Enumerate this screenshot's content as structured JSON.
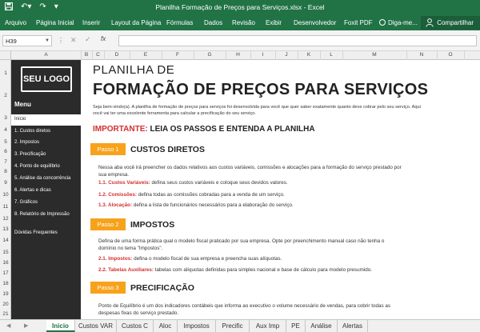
{
  "window": {
    "title": "Planilha Formação de Preços para Serviços.xlsx - Excel"
  },
  "ribbon": {
    "tabs": [
      "Arquivo",
      "Página Inicial",
      "Inserir",
      "Layout da Página",
      "Fórmulas",
      "Dados",
      "Revisão",
      "Exibir",
      "Desenvolvedor",
      "Foxit PDF"
    ],
    "tell_me": "Diga-me...",
    "share": "Compartilhar"
  },
  "formula_bar": {
    "name_box": "H39",
    "fx": "fx",
    "value": ""
  },
  "columns": [
    "A",
    "B",
    "C",
    "D",
    "E",
    "F",
    "G",
    "H",
    "I",
    "J",
    "K",
    "L",
    "M",
    "N",
    "O"
  ],
  "rows": [
    "1",
    "2",
    "3",
    "4",
    "5",
    "6",
    "7",
    "8",
    "9",
    "10",
    "11",
    "12",
    "13",
    "14",
    "15",
    "16",
    "17",
    "18",
    "19",
    "20",
    "21"
  ],
  "sidebar": {
    "logo": "SEU LOGO",
    "menu_title": "Menu",
    "items": [
      "Início",
      "1. Custos diretos",
      "2. Impostos",
      "3. Precificação",
      "4. Ponto de equilíbrio",
      "5. Análise da concorrência",
      "6. Alertas e dicas",
      "7. Gráficos",
      "8. Relatório de Impressão",
      "Dúvidas Frequentes"
    ],
    "active_index": 0
  },
  "content": {
    "subtitle": "PLANILHA DE",
    "title": "FORMAÇÃO DE PREÇOS PARA SERVIÇOS",
    "intro": "Seja bem-vindo(a). A planilha de formação de preços para serviços foi desenvolvida para você que quer saber exatamente quanto deve cobrar pelo seu serviço. Aqui você vai ter uma excelente ferramenta para calcular a precificação do seu serviço.",
    "important_label": "IMPORTANTE:",
    "important_text": "LEIA OS PASSOS E ENTENDA A PLANILHA",
    "steps": [
      {
        "badge": "Passo 1",
        "title": "CUSTOS DIRETOS",
        "text": "Nessa aba você irá preencher os dados relativos aos custos variáveis, comissões e alocações para a formação do serviço prestado por sua empresa.",
        "subs": [
          {
            "label": "1.1. Custos Variáveis:",
            "text": "defina seus custos variáveis e coloque seus devidos valores."
          },
          {
            "label": "1.2. Comissões:",
            "text": "defina todas as comissões cobradas para a venda de um serviço."
          },
          {
            "label": "1.3. Alocação:",
            "text": "defina a lista de funcionários necessários para a elaboração do serviço."
          }
        ]
      },
      {
        "badge": "Passo 2",
        "title": "IMPOSTOS",
        "text": "Defina de uma forma prática qual o modelo fiscal praticado por sua empresa. Opte por preenchimento manual caso não tenha o domínio no tema \"Impostos\".",
        "subs": [
          {
            "label": "2.1. Impostos:",
            "text": "defina o modelo fiscal de sua empresa e preencha suas alíquotas."
          },
          {
            "label": "2.2. Tabelas Auxiliares:",
            "text": "tabelas com alíquotas definidas para simples nacional e base de cálculo para modelo presumido."
          }
        ]
      },
      {
        "badge": "Passo 3",
        "title": "PRECIFICAÇÃO",
        "text": "Ponto de Equilíbrio é um dos indicadores contábeis que informa ao executivo o volume necessário de vendas, para cobrir todas as despesas fixas do serviço prestado.",
        "subs": []
      }
    ]
  },
  "sheet_tabs": [
    "Inicio",
    "Custos VAR",
    "Custos C",
    "Aloc",
    "Impostos",
    "Precific",
    "Aux Imp",
    "PE",
    "Análise",
    "Alertas"
  ],
  "active_sheet": 0,
  "colors": {
    "excel_green": "#217346",
    "sidebar_bg": "#2b2b2b",
    "step_orange": "#f7a21b",
    "accent_red": "#d32f2f"
  }
}
